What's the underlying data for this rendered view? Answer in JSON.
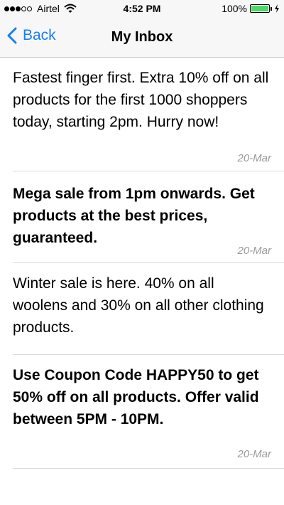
{
  "status_bar": {
    "carrier": "Airtel",
    "time": "4:52 PM",
    "battery": "100%",
    "signal_bars_filled": 3,
    "signal_bars_total": 5,
    "battery_level": 1.0
  },
  "nav": {
    "back_label": "Back",
    "title": "My Inbox"
  },
  "messages": [
    {
      "text": "Fastest finger first. Extra 10% off on all products for the first 1000 shoppers today, starting 2pm. Hurry now!",
      "date": "20-Mar",
      "unread": false
    },
    {
      "text": "Mega sale from 1pm onwards. Get products at the best prices, guaranteed.",
      "date": "20-Mar",
      "unread": true
    },
    {
      "text": "Winter sale is here. 40% on all woolens and 30% on all other clothing products.",
      "date": "",
      "unread": false
    },
    {
      "text": "Use Coupon Code HAPPY50 to get 50% off on all products. Offer valid between 5PM - 10PM.",
      "date": "20-Mar",
      "unread": true
    }
  ],
  "colors": {
    "accent": "#157efb",
    "battery": "#4cd964",
    "date": "#9a9a9a"
  }
}
